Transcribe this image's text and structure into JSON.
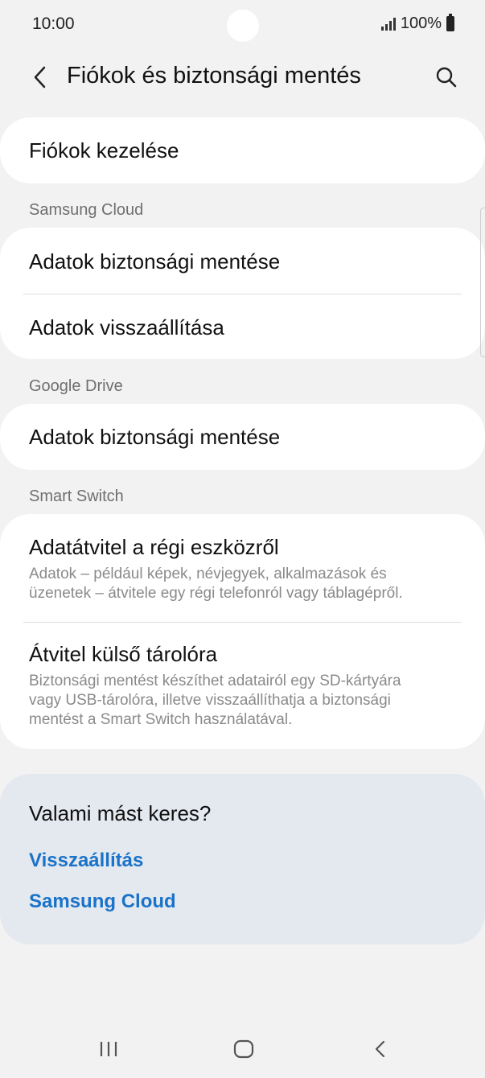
{
  "status_bar": {
    "time": "10:00",
    "battery_text": "100%"
  },
  "header": {
    "title": "Fiókok és biztonsági mentés",
    "back_icon": "chevron-left-icon",
    "search_icon": "search-icon"
  },
  "accounts_card": {
    "manage_accounts": "Fiókok kezelése"
  },
  "samsung_cloud": {
    "section_label": "Samsung Cloud",
    "backup_label": "Adatok biztonsági mentése",
    "restore_label": "Adatok visszaállítása"
  },
  "google_drive": {
    "section_label": "Google Drive",
    "backup_label": "Adatok biztonsági mentése"
  },
  "smart_switch": {
    "section_label": "Smart Switch",
    "transfer_title": "Adatátvitel a régi eszközről",
    "transfer_desc_line1": "Adatok – például képek, névjegyek, alkalmazások és",
    "transfer_desc_line2": "üzenetek – átvitele egy régi telefonról vagy táblagépről.",
    "external_title": "Átvitel külső tárolóra",
    "external_desc_line1": "Biztonsági mentést készíthet adatairól egy SD-kártyára",
    "external_desc_line2": "vagy USB-tárolóra, illetve visszaállíthatja a biztonsági",
    "external_desc_line3": "mentést a Smart Switch használatával."
  },
  "suggestions": {
    "title": "Valami mást keres?",
    "link1": "Visszaállítás",
    "link2": "Samsung Cloud",
    "link_color": "#1a73c8"
  },
  "nav_bar": {
    "recents_icon": "recents-icon",
    "home_icon": "home-icon",
    "back_icon": "back-icon"
  }
}
